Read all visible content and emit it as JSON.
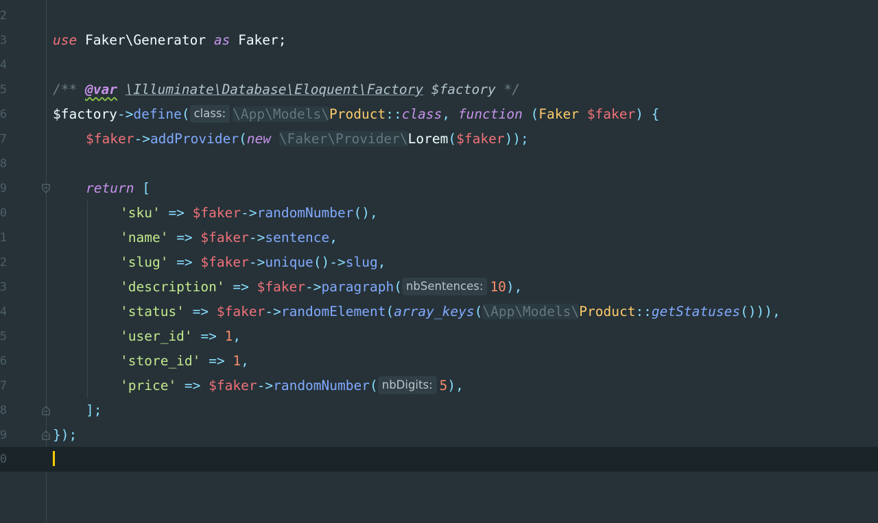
{
  "editor": {
    "line_numbers": [
      "2",
      "3",
      "4",
      "5",
      "6",
      "7",
      "8",
      "9",
      "0",
      "1",
      "2",
      "3",
      "4",
      "5",
      "6",
      "7",
      "8",
      "9",
      "0"
    ],
    "lines": {
      "l3": {
        "use": "use",
        "ns": "Faker\\Generator",
        "as": "as",
        "alias": "Faker;"
      },
      "l5": {
        "open": "/** ",
        "tag": "@var",
        "type": "\\Illuminate\\Database\\Eloquent\\Factory",
        "var": "$factory",
        "close": " */"
      },
      "l6": {
        "var": "$factory",
        "arrow": "->",
        "fn": "define",
        "paren": "(",
        "hint": "class:",
        "ns": "\\App\\Models\\",
        "cls": "Product",
        "sep": "::",
        "kw_class": "class",
        "comma": ", ",
        "kw_function": "function",
        "paren2": " (",
        "type": "Faker",
        "param": "$faker",
        "tail": ") {"
      },
      "l7": {
        "var": "$faker",
        "arrow": "->",
        "fn": "addProvider",
        "paren": "(",
        "kw_new": "new",
        "ns": "\\Faker\\Provider\\",
        "cls": "Lorem",
        "paren2": "(",
        "arg": "$faker",
        "tail": "));"
      },
      "l9": {
        "kw_return": "return",
        "bracket": " ["
      },
      "l10": {
        "key": "'sku'",
        "arrow": " => ",
        "var": "$faker",
        "op": "->",
        "fn": "randomNumber",
        "tail": "(),"
      },
      "l11": {
        "key": "'name'",
        "arrow": " => ",
        "var": "$faker",
        "op": "->",
        "fn": "sentence",
        "tail": ","
      },
      "l12": {
        "key": "'slug'",
        "arrow": " => ",
        "var": "$faker",
        "op": "->",
        "fn": "unique",
        "mid": "()->",
        "fn2": "slug",
        "tail": ","
      },
      "l13": {
        "key": "'description'",
        "arrow": " => ",
        "var": "$faker",
        "op": "->",
        "fn": "paragraph",
        "paren": "(",
        "hint": "nbSentences:",
        "num": "10",
        "tail": "),"
      },
      "l14": {
        "key": "'status'",
        "arrow": " => ",
        "var": "$faker",
        "op": "->",
        "fn": "randomElement",
        "paren": "(",
        "fn2": "array_keys",
        "paren2": "(",
        "ns": "\\App\\Models\\",
        "cls": "Product",
        "sep": "::",
        "fn3": "getStatuses",
        "tail": "())),"
      },
      "l15": {
        "key": "'user_id'",
        "arrow": " => ",
        "num": "1",
        "tail": ","
      },
      "l16": {
        "key": "'store_id'",
        "arrow": " => ",
        "num": "1",
        "tail": ","
      },
      "l17": {
        "key": "'price'",
        "arrow": " => ",
        "var": "$faker",
        "op": "->",
        "fn": "randomNumber",
        "paren": "(",
        "hint": "nbDigits:",
        "num": "5",
        "tail": "),"
      },
      "l18": {
        "text": "];"
      },
      "l19": {
        "text": "});"
      }
    }
  }
}
